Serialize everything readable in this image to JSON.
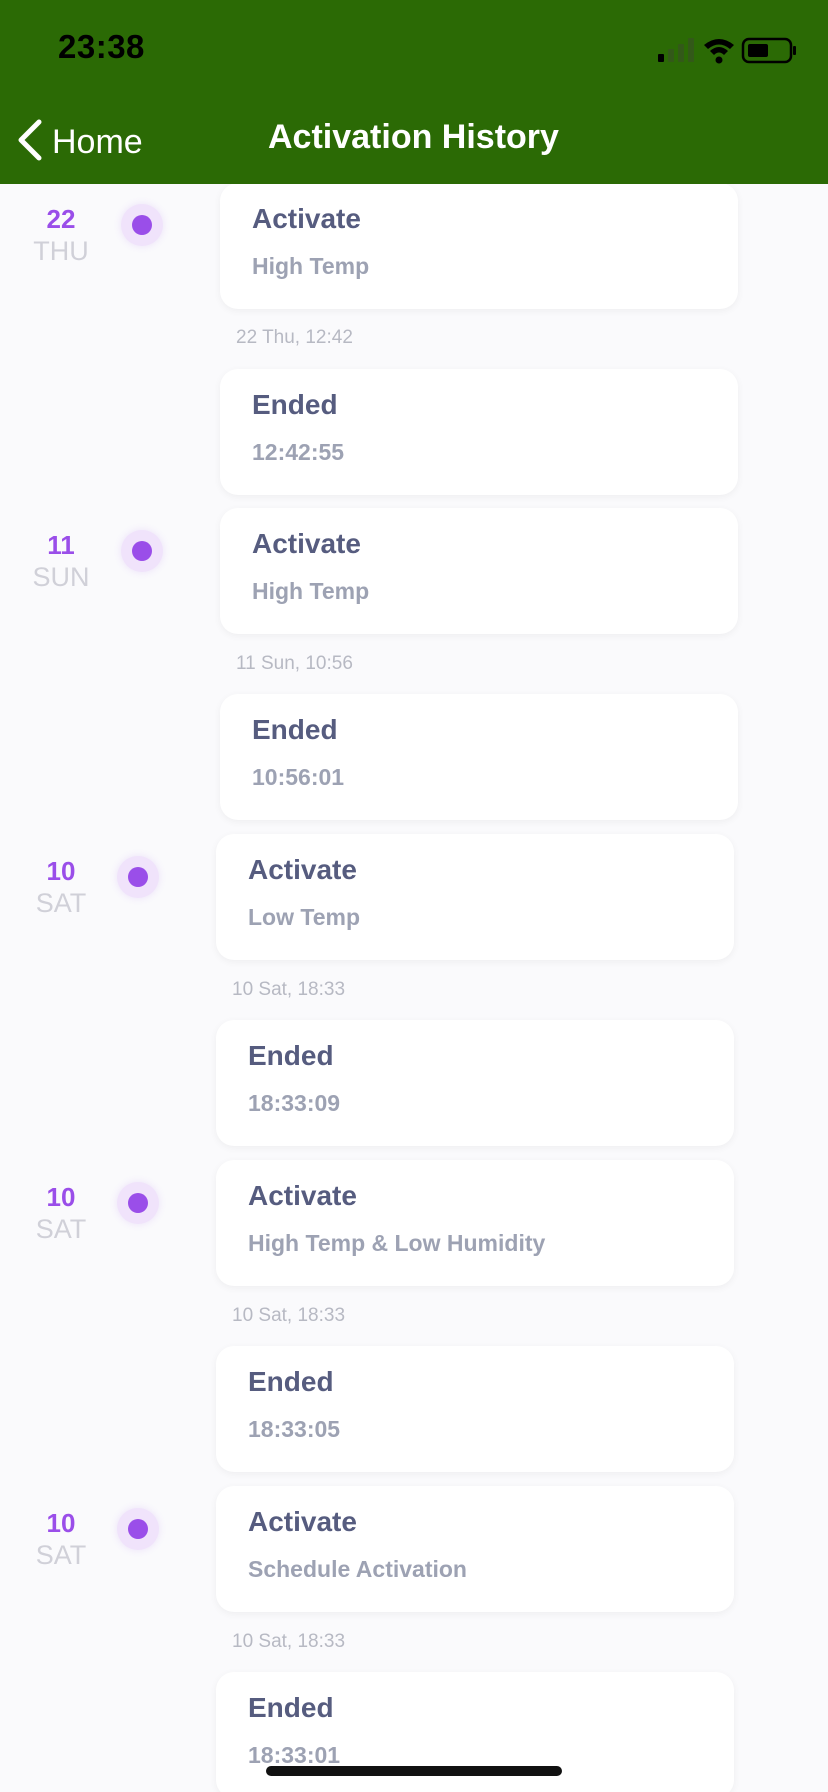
{
  "status_bar": {
    "time": "23:38"
  },
  "nav": {
    "back_label": "Home",
    "title": "Activation History"
  },
  "entries": [
    {
      "date_num": "22",
      "date_day": "THU",
      "activate_label": "Activate",
      "trigger": "High Temp",
      "timestamp": "22 Thu, 12:42",
      "ended_label": "Ended",
      "ended_time": "12:42:55"
    },
    {
      "date_num": "11",
      "date_day": "SUN",
      "activate_label": "Activate",
      "trigger": "High Temp",
      "timestamp": "11 Sun, 10:56",
      "ended_label": "Ended",
      "ended_time": "10:56:01"
    },
    {
      "date_num": "10",
      "date_day": "SAT",
      "activate_label": "Activate",
      "trigger": "Low Temp",
      "timestamp": "10 Sat, 18:33",
      "ended_label": "Ended",
      "ended_time": "18:33:09"
    },
    {
      "date_num": "10",
      "date_day": "SAT",
      "activate_label": "Activate",
      "trigger": "High Temp & Low Humidity",
      "timestamp": "10 Sat, 18:33",
      "ended_label": "Ended",
      "ended_time": "18:33:05"
    },
    {
      "date_num": "10",
      "date_day": "SAT",
      "activate_label": "Activate",
      "trigger": "Schedule Activation",
      "timestamp": "10 Sat, 18:33",
      "ended_label": "Ended",
      "ended_time": "18:33:01"
    }
  ],
  "colors": {
    "header": "#2b6a05",
    "accent": "#9a4ee9"
  }
}
